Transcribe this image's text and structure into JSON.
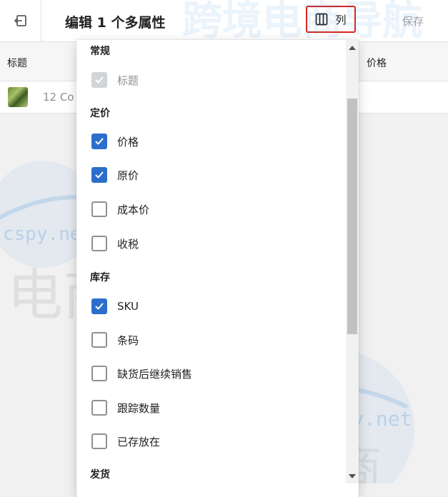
{
  "header": {
    "title": "编辑 1 个多属性",
    "columns_label": "列",
    "save_label": "保存"
  },
  "table": {
    "col_title": "标题",
    "col_price": "价格",
    "row_text": "12 Co"
  },
  "dropdown": {
    "groups": [
      {
        "label": "常规",
        "options": [
          {
            "label": "标题",
            "state": "disabled-checked"
          }
        ]
      },
      {
        "label": "定价",
        "options": [
          {
            "label": "价格",
            "state": "checked"
          },
          {
            "label": "原价",
            "state": "checked"
          },
          {
            "label": "成本价",
            "state": "unchecked"
          },
          {
            "label": "收税",
            "state": "unchecked"
          }
        ]
      },
      {
        "label": "库存",
        "options": [
          {
            "label": "SKU",
            "state": "checked"
          },
          {
            "label": "条码",
            "state": "unchecked"
          },
          {
            "label": "缺货后继续销售",
            "state": "unchecked"
          },
          {
            "label": "跟踪数量",
            "state": "unchecked"
          },
          {
            "label": "已存放在",
            "state": "unchecked"
          }
        ]
      },
      {
        "label": "发货",
        "options": []
      }
    ]
  },
  "watermark": {
    "text_1": "跨境电商导航",
    "text_2": "cspy.net",
    "text_3": "电商导航",
    "text_4": "idcspy.net",
    "text_5": "跨境电商"
  },
  "colors": {
    "accent_blue": "#2c6ecb",
    "highlight_red": "#d9261c",
    "watermark_blue": "#3b8ad9"
  },
  "icons": {
    "back": "exit-icon",
    "columns": "columns-icon",
    "check": "check-icon"
  }
}
